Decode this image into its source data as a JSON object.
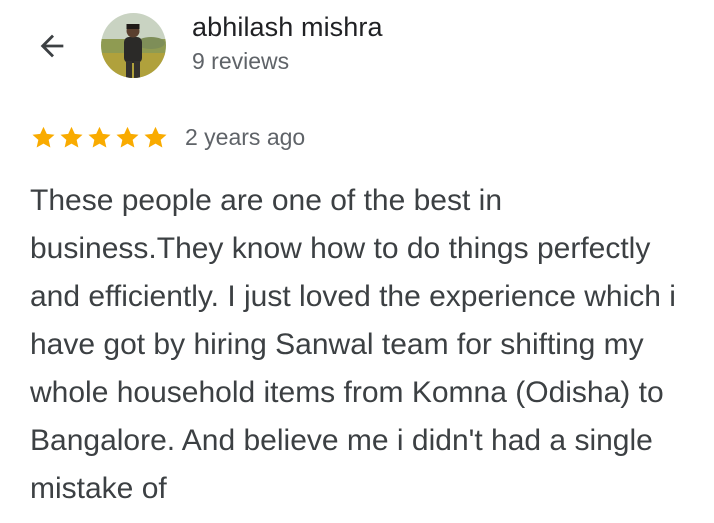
{
  "reviewer": {
    "name": "abhilash mishra",
    "review_count": "9 reviews"
  },
  "icons": {
    "back": "arrow-back-icon",
    "avatar": "profile-photo",
    "star": "star-icon"
  },
  "review": {
    "rating": 5,
    "rating_max": 5,
    "date": "2 years ago",
    "text": "These people are one of the best in business.They know how to do things perfectly and efficiently. I just loved the experience which i have got by hiring Sanwal team for shifting my whole household items from Komna (Odisha) to Bangalore. And believe me i didn't had a single mistake of"
  },
  "colors": {
    "star": "#f9ab00",
    "name": "#202124",
    "secondary": "#5f6368",
    "body": "#3c4043"
  }
}
